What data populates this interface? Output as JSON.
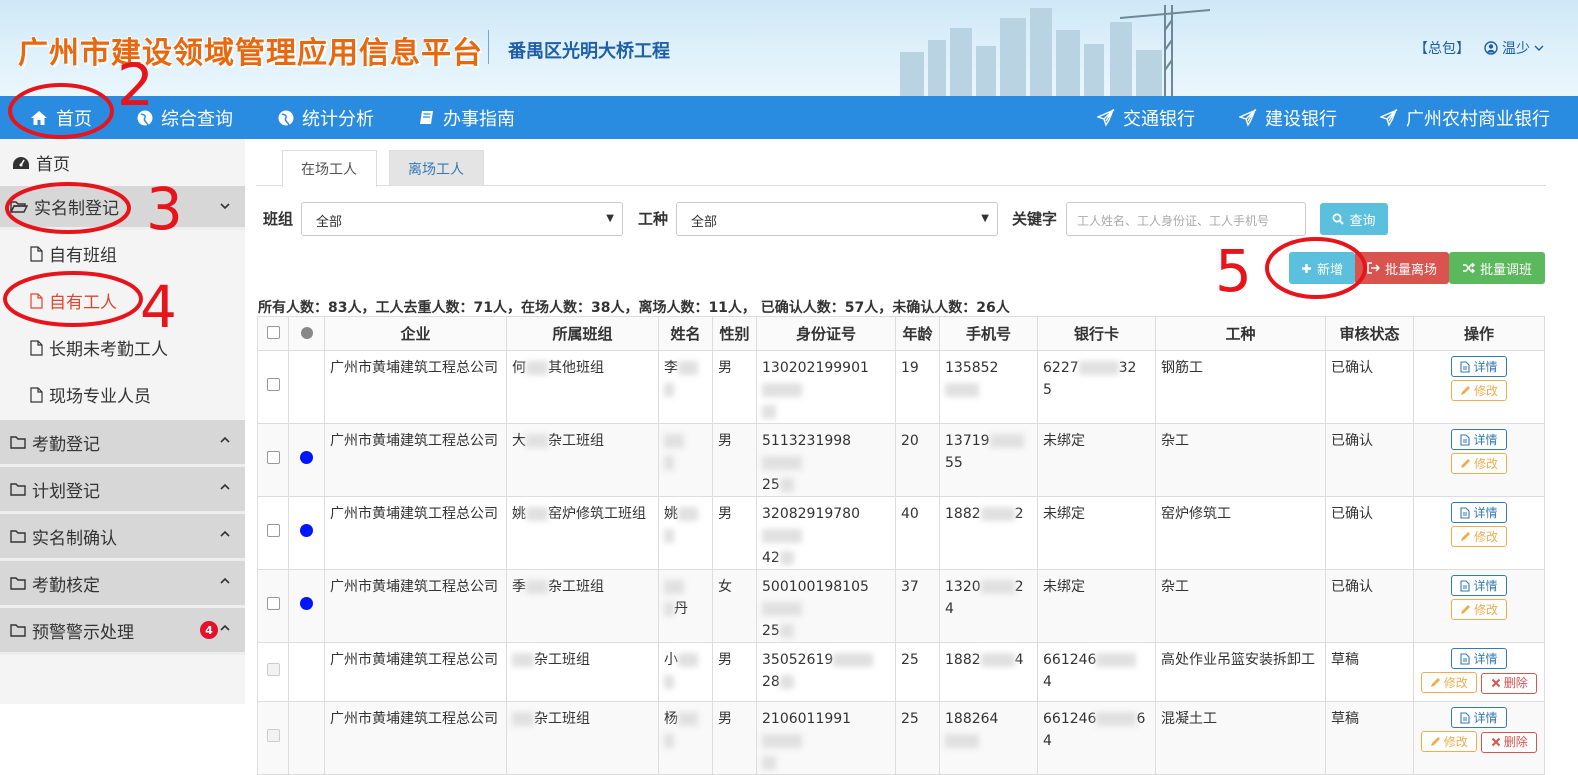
{
  "header": {
    "title": "广州市建设领域管理应用信息平台",
    "project": "番禺区光明大桥工程",
    "top_link": "【总包】",
    "user": "温少"
  },
  "nav": {
    "left": [
      {
        "label": "首页",
        "icon": "home-icon"
      },
      {
        "label": "综合查询",
        "icon": "globe-icon"
      },
      {
        "label": "统计分析",
        "icon": "globe-icon"
      },
      {
        "label": "办事指南",
        "icon": "book-icon"
      }
    ],
    "right": [
      {
        "label": "交通银行",
        "icon": "paper-plane-icon"
      },
      {
        "label": "建设银行",
        "icon": "paper-plane-icon"
      },
      {
        "label": "广州农村商业银行",
        "icon": "paper-plane-icon"
      }
    ]
  },
  "sidebar": {
    "home": "首页",
    "realname_group": "实名制登记",
    "realname_items": [
      "自有班组",
      "自有工人",
      "长期未考勤工人",
      "现场专业人员"
    ],
    "groups": [
      "考勤登记",
      "计划登记",
      "实名制确认",
      "考勤核定",
      "预警警示处理"
    ],
    "alert_badge": "4"
  },
  "tabs": [
    "在场工人",
    "离场工人"
  ],
  "filters": {
    "team_label": "班组",
    "team_value": "全部",
    "trade_label": "工种",
    "trade_value": "全部",
    "keyword_label": "关键字",
    "keyword_placeholder": "工人姓名、工人身份证、工人手机号",
    "query_button": "查询"
  },
  "actions": {
    "add": "新增",
    "batch_leave": "批量离场",
    "batch_transfer": "批量调班"
  },
  "summary": "所有人数：83人，工人去重人数：71人，在场人数：38人，离场人数：11人， 已确认人数：57人，未确认人数：26人",
  "table": {
    "headers": [
      "企业",
      "所属班组",
      "姓名",
      "性别",
      "身份证号",
      "年龄",
      "手机号",
      "银行卡",
      "工种",
      "审核状态",
      "操作"
    ],
    "op_labels": {
      "detail": "详情",
      "edit": "修改",
      "delete": "删除"
    },
    "rows": [
      {
        "dot": false,
        "disabled": false,
        "company": "广州市黄埔建筑工程总公司",
        "team_a": "何",
        "team_b": "其他班组",
        "name_a": "李",
        "name_b": "",
        "gender": "男",
        "id_a": "130202199901",
        "id_b": "",
        "age": "19",
        "phone_a": "135852",
        "phone_b": "",
        "bank_a": "6227",
        "bank_b": "32",
        "bank_c": "5",
        "trade": "钢筋工",
        "status": "已确认",
        "deletable": false
      },
      {
        "dot": true,
        "disabled": false,
        "company": "广州市黄埔建筑工程总公司",
        "team_a": "大",
        "team_b": "杂工班组",
        "name_a": "",
        "name_b": "",
        "gender": "男",
        "id_a": "5113231998",
        "id_b": "25",
        "age": "20",
        "phone_a": "13719",
        "phone_b": "55",
        "bank_a": "未绑定",
        "bank_b": "",
        "bank_c": "",
        "trade": "杂工",
        "status": "已确认",
        "deletable": false
      },
      {
        "dot": true,
        "disabled": false,
        "company": "广州市黄埔建筑工程总公司",
        "team_a": "姚",
        "team_b": "窑炉修筑工班组",
        "name_a": "姚",
        "name_b": "",
        "gender": "男",
        "id_a": "32082919780",
        "id_b": "42",
        "age": "40",
        "phone_a": "1882",
        "phone_b": "2",
        "bank_a": "未绑定",
        "bank_b": "",
        "bank_c": "",
        "trade": "窑炉修筑工",
        "status": "已确认",
        "deletable": false
      },
      {
        "dot": true,
        "disabled": false,
        "company": "广州市黄埔建筑工程总公司",
        "team_a": "季",
        "team_b": "杂工班组",
        "name_a": "",
        "name_b": "丹",
        "gender": "女",
        "id_a": "500100198105",
        "id_b": "25",
        "age": "37",
        "phone_a": "1320",
        "phone_b": "24",
        "bank_a": "未绑定",
        "bank_b": "",
        "bank_c": "",
        "trade": "杂工",
        "status": "已确认",
        "deletable": false
      },
      {
        "dot": false,
        "disabled": true,
        "company": "广州市黄埔建筑工程总公司",
        "team_a": "",
        "team_b": "杂工班组",
        "name_a": "小",
        "name_b": "",
        "gender": "男",
        "id_a": "35052619",
        "id_b": "28",
        "age": "25",
        "phone_a": "1882",
        "phone_b": "4",
        "bank_a": "661246",
        "bank_b": "",
        "bank_c": "4",
        "trade": "高处作业吊篮安装拆卸工",
        "status": "草稿",
        "deletable": true
      },
      {
        "dot": false,
        "disabled": true,
        "company": "广州市黄埔建筑工程总公司",
        "team_a": "",
        "team_b": "杂工班组",
        "name_a": "杨",
        "name_b": "",
        "gender": "男",
        "id_a": "2106011991",
        "id_b": "",
        "age": "25",
        "phone_a": "188264",
        "phone_b": "",
        "bank_a": "661246",
        "bank_b": "6",
        "bank_c": "4",
        "trade": "混凝土工",
        "status": "草稿",
        "deletable": true
      }
    ]
  },
  "annotations": [
    "2",
    "3",
    "4",
    "5"
  ],
  "colors": {
    "nav": "#2a8ce0",
    "title": "#e8680f",
    "annotation": "#e8141b",
    "query": "#5bc0de",
    "danger": "#d9534f",
    "success": "#5cb85c"
  }
}
